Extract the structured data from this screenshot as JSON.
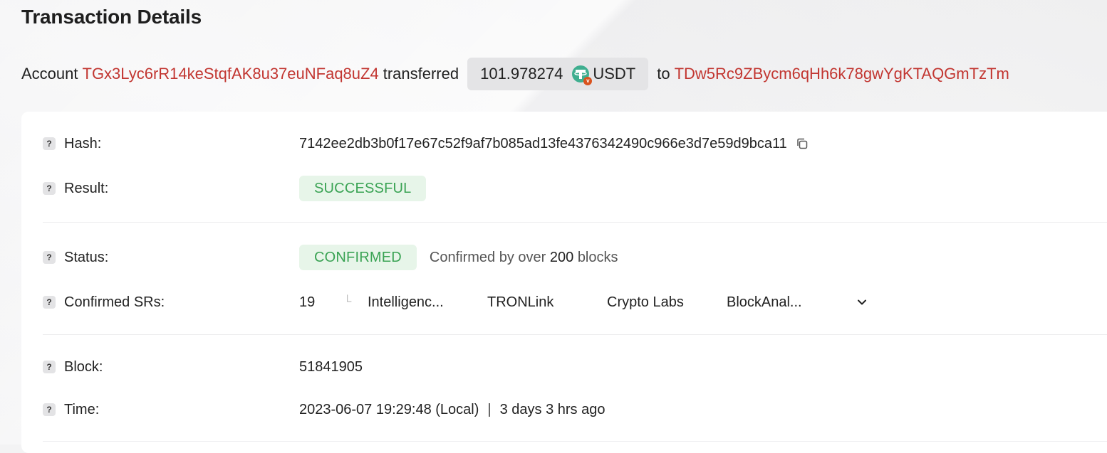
{
  "page": {
    "title": "Transaction Details"
  },
  "summary": {
    "prefix": "Account",
    "from_address": "TGx3Lyc6rR14keStqfAK8u37euNFaq8uZ4",
    "verb": "transferred",
    "amount": "101.978274",
    "token": "USDT",
    "token_icon": "tether-icon",
    "to_word": "to",
    "to_address": "TDw5Rc9ZBycm6qHh6k78gwYgKTAQGmTzTm"
  },
  "details": {
    "hash": {
      "label": "Hash:",
      "value": "7142ee2db3b0f17e67c52f9af7b085ad13fe4376342490c966e3d7e59d9bca11"
    },
    "result": {
      "label": "Result:",
      "value": "SUCCESSFUL"
    },
    "status": {
      "label": "Status:",
      "value": "CONFIRMED",
      "note_prefix": "Confirmed by over",
      "note_count": "200",
      "note_suffix": "blocks"
    },
    "confirmed_srs": {
      "label": "Confirmed SRs:",
      "count": "19",
      "items": [
        "Intelligenc...",
        "TRONLink",
        "Crypto Labs",
        "BlockAnal..."
      ]
    },
    "block": {
      "label": "Block:",
      "value": "51841905"
    },
    "time": {
      "label": "Time:",
      "value": "2023-06-07 19:29:48 (Local)",
      "separator": "|",
      "relative": "3 days 3 hrs ago"
    }
  },
  "colors": {
    "address": "#c23631",
    "success_bg": "#e7f5e9",
    "success_text": "#3aa354",
    "pill_bg": "#e4e4e6"
  }
}
